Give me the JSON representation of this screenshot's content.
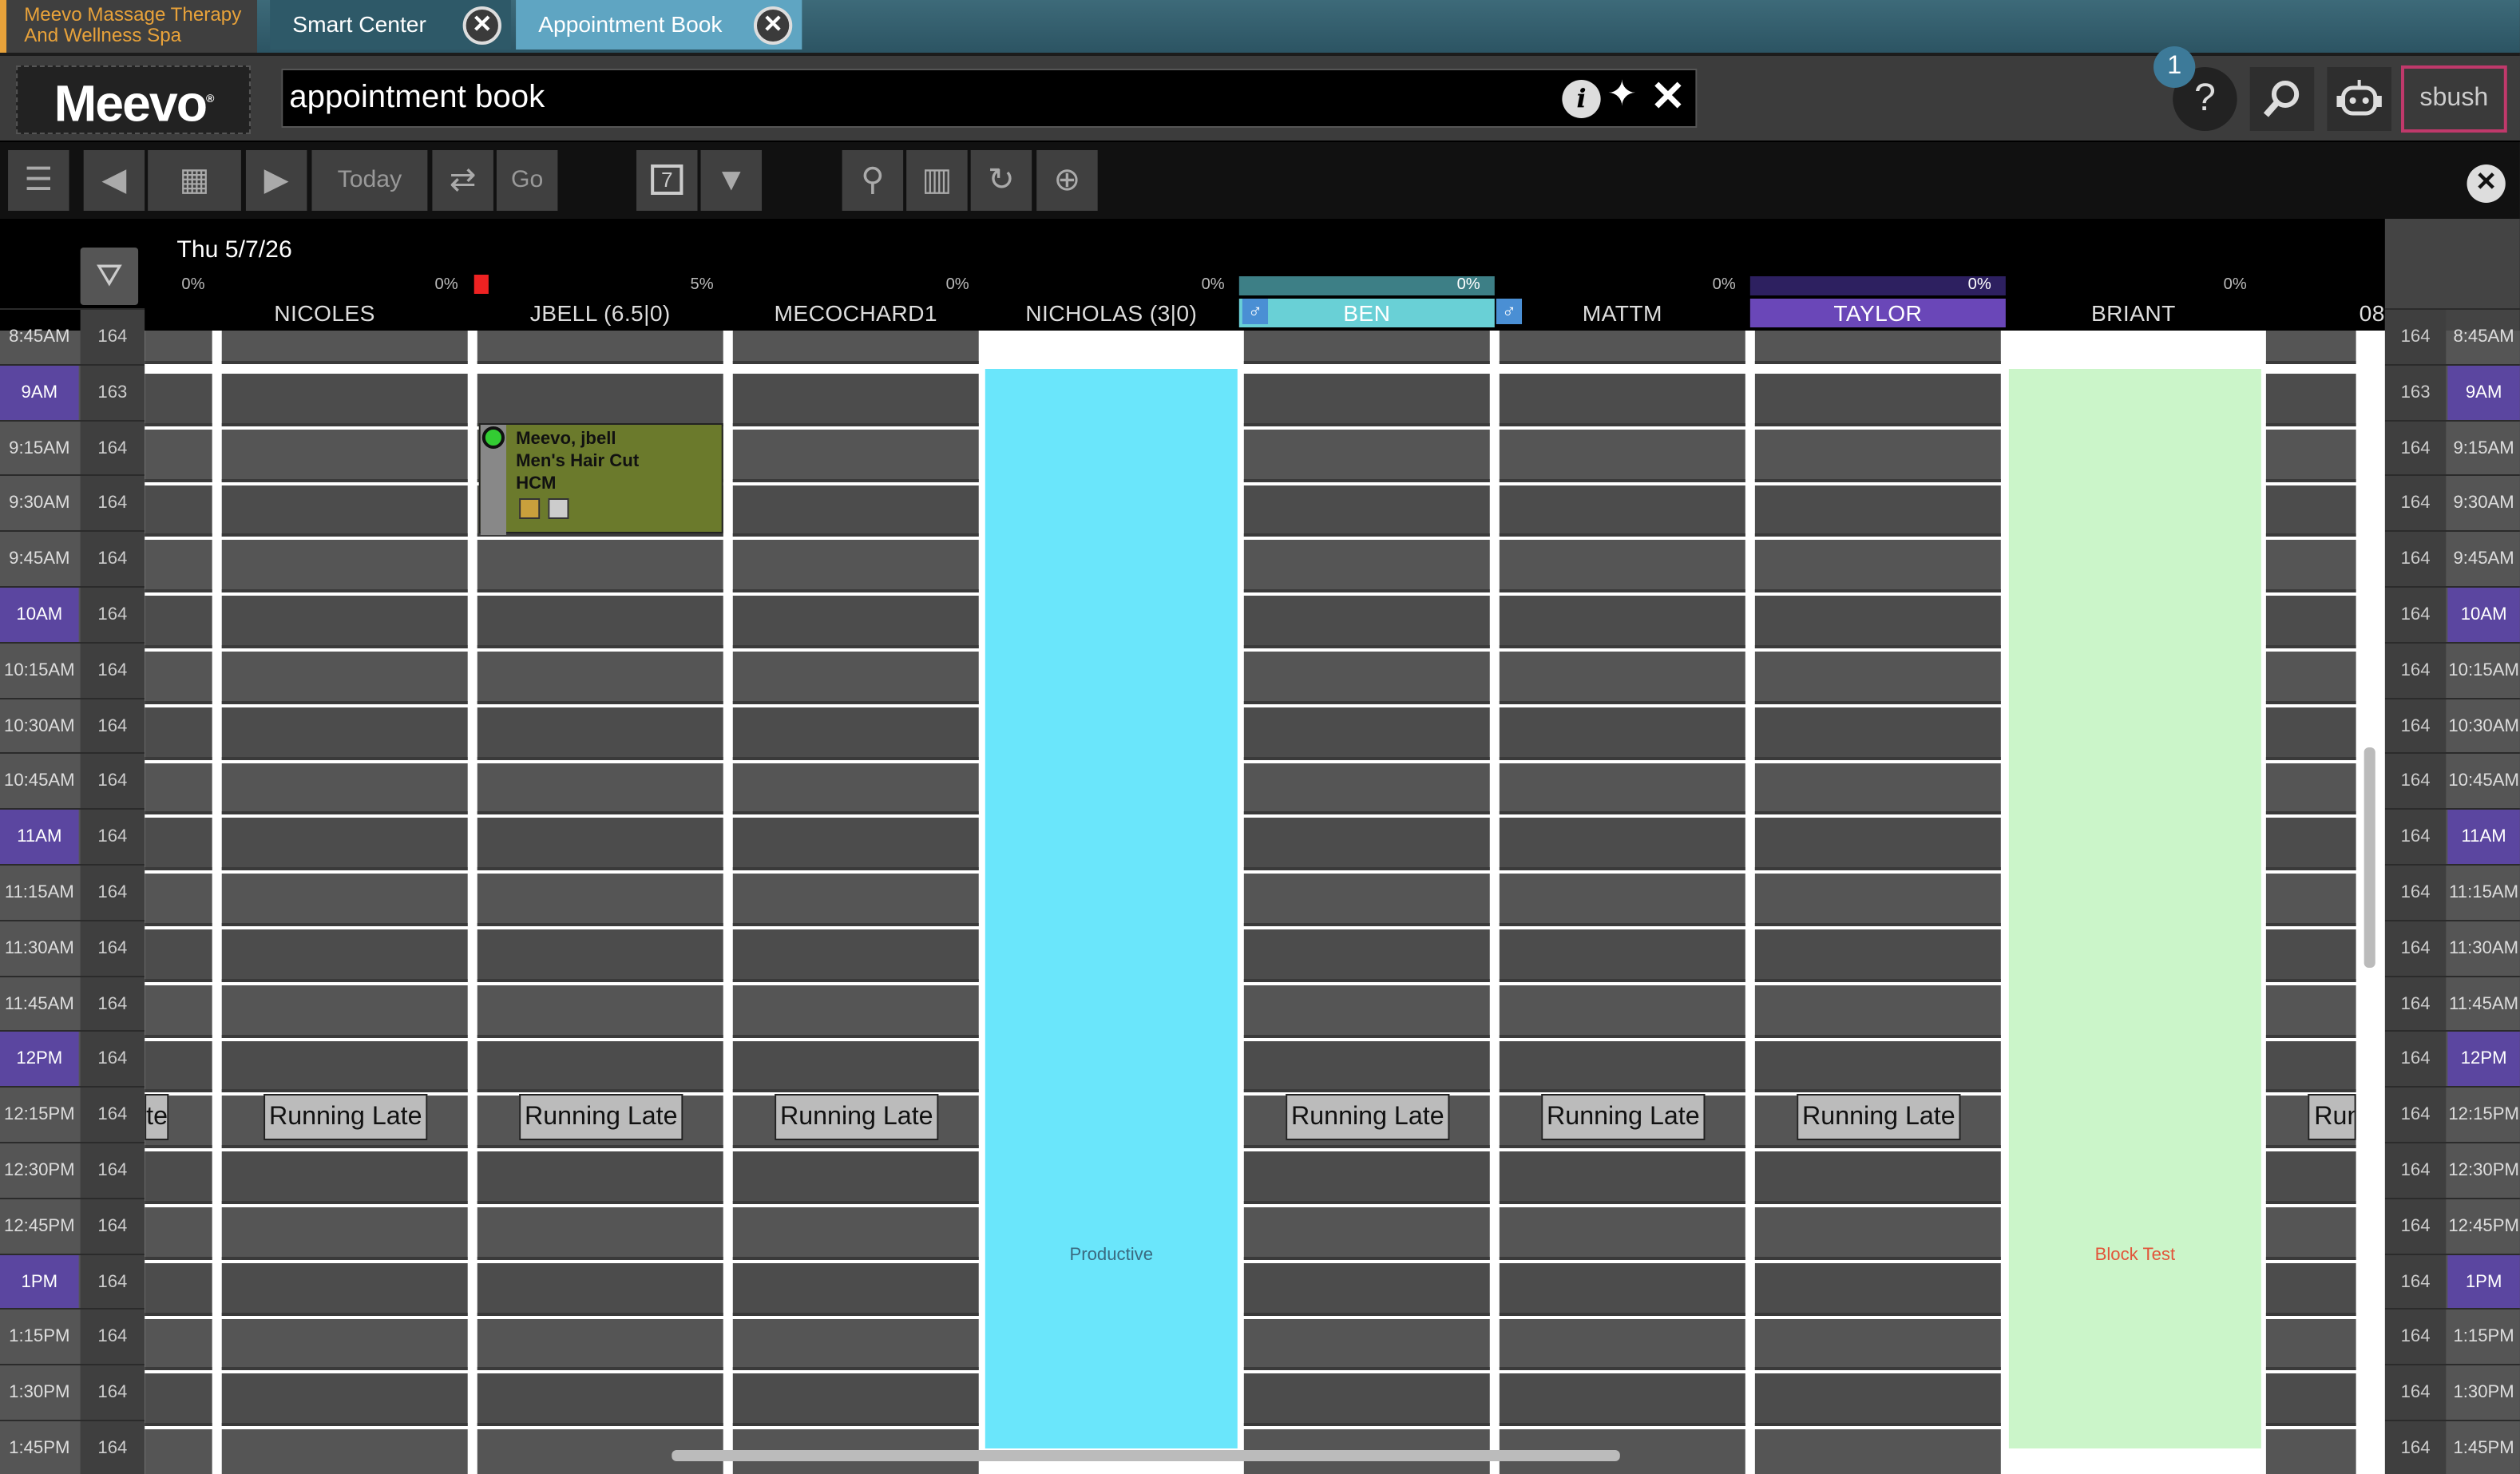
{
  "tabs": {
    "org": "Meevo Massage Therapy And Wellness Spa",
    "smart_center": "Smart Center",
    "appointment_book": "Appointment Book"
  },
  "header": {
    "logo": "Meevo",
    "search_value": "appointment book",
    "notification_count": "1",
    "user": "sbush"
  },
  "toolbar": {
    "today": "Today",
    "go": "Go",
    "calendar_day": "7"
  },
  "book": {
    "date": "Thu 5/7/26",
    "columns": [
      {
        "name": "NICOLES",
        "pct_l": "0%",
        "pct_r": "0%"
      },
      {
        "name": "JBELL  (6.5|0)",
        "pct_l": "",
        "pct_r": "5%"
      },
      {
        "name": "MECOCHARD1",
        "pct_l": "",
        "pct_r": "0%"
      },
      {
        "name": "NICHOLAS  (3|0)",
        "pct_l": "",
        "pct_r": "0%"
      },
      {
        "name": "BEN",
        "pct_l": "",
        "pct_r": "0%"
      },
      {
        "name": "MATTM",
        "pct_l": "",
        "pct_r": "0%"
      },
      {
        "name": "TAYLOR",
        "pct_l": "",
        "pct_r": "0%"
      },
      {
        "name": "BRIANT",
        "pct_l": "",
        "pct_r": "0%"
      },
      {
        "name": "08",
        "pct_l": "",
        "pct_r": ""
      }
    ],
    "times": [
      {
        "t": "8:45AM",
        "n": "164"
      },
      {
        "t": "9AM",
        "n": "163"
      },
      {
        "t": "9:15AM",
        "n": "164"
      },
      {
        "t": "9:30AM",
        "n": "164"
      },
      {
        "t": "9:45AM",
        "n": "164"
      },
      {
        "t": "10AM",
        "n": "164"
      },
      {
        "t": "10:15AM",
        "n": "164"
      },
      {
        "t": "10:30AM",
        "n": "164"
      },
      {
        "t": "10:45AM",
        "n": "164"
      },
      {
        "t": "11AM",
        "n": "164"
      },
      {
        "t": "11:15AM",
        "n": "164"
      },
      {
        "t": "11:30AM",
        "n": "164"
      },
      {
        "t": "11:45AM",
        "n": "164"
      },
      {
        "t": "12PM",
        "n": "164"
      },
      {
        "t": "12:15PM",
        "n": "164"
      },
      {
        "t": "12:30PM",
        "n": "164"
      },
      {
        "t": "12:45PM",
        "n": "164"
      },
      {
        "t": "1PM",
        "n": "164"
      },
      {
        "t": "1:15PM",
        "n": "164"
      },
      {
        "t": "1:30PM",
        "n": "164"
      },
      {
        "t": "1:45PM",
        "n": "164"
      }
    ],
    "running_late": "Running Late",
    "running_late_partial_left": "te",
    "running_late_partial_right": "Run",
    "appointment": {
      "line1": "Meevo, jbell",
      "line2": "Men's Hair Cut",
      "line3": "HCM"
    },
    "block_productive": "Productive",
    "block_test": "Block Test"
  },
  "colors": {
    "accent_purple": "#5b46a0",
    "productive_block": "#6ae6fb",
    "block_test": "#cbf5c9",
    "user_border": "#c0396b"
  }
}
